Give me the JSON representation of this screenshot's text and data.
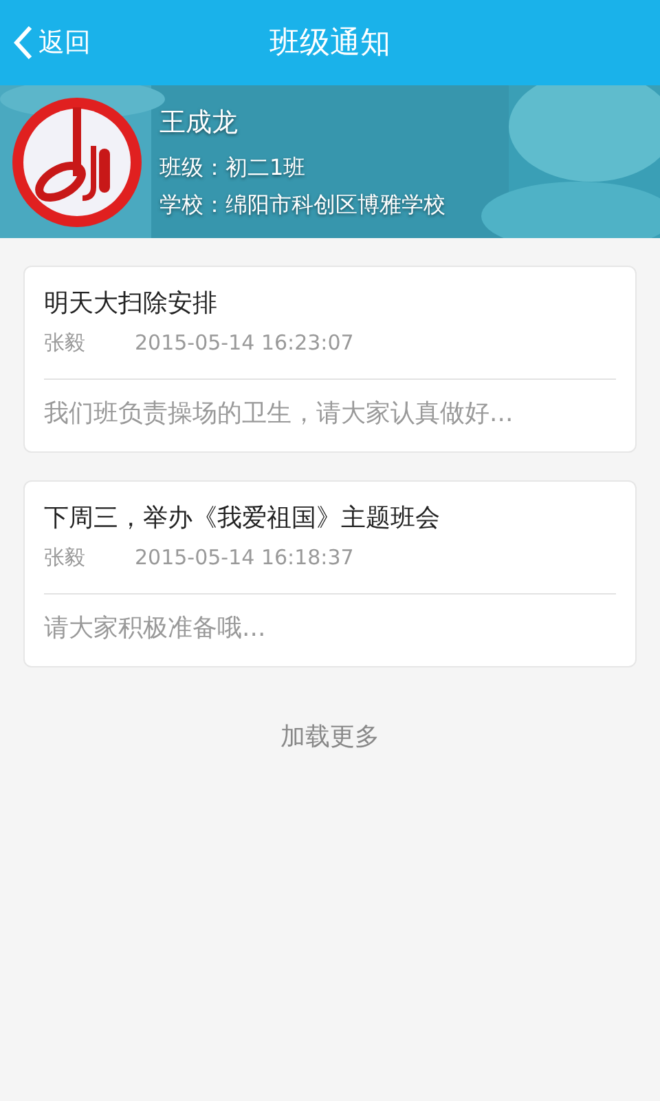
{
  "header": {
    "back_label": "返回",
    "title": "班级通知"
  },
  "profile": {
    "name": "王成龙",
    "class_line": "班级：初二1班",
    "school_line": "学校：绵阳市科创区博雅学校"
  },
  "notices": [
    {
      "title": "明天大扫除安排",
      "author": "张毅",
      "time": "2015-05-14 16:23:07",
      "preview": "我们班负责操场的卫生，请大家认真做好..."
    },
    {
      "title": "下周三，举办《我爱祖国》主题班会",
      "author": "张毅",
      "time": "2015-05-14 16:18:37",
      "preview": "请大家积极准备哦..."
    }
  ],
  "load_more": "加载更多"
}
